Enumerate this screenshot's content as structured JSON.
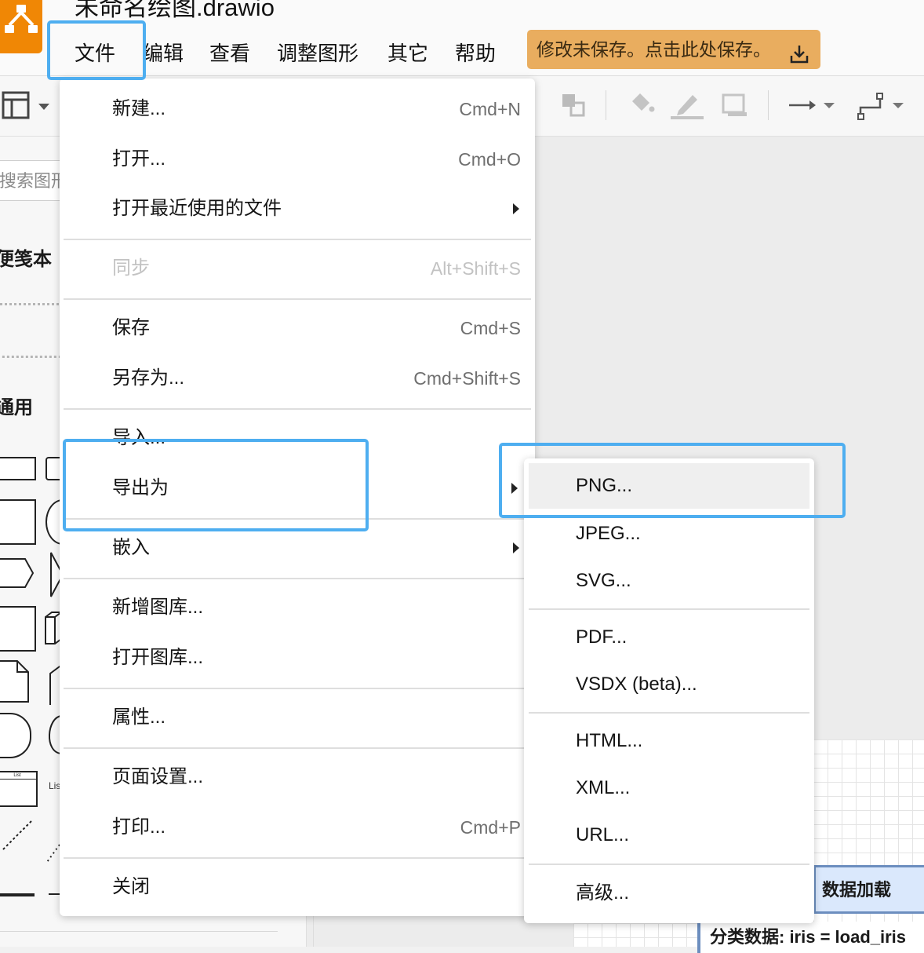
{
  "window": {
    "title": "未命名绘图.drawio"
  },
  "menubar": {
    "items": [
      "文件",
      "编辑",
      "查看",
      "调整图形",
      "其它",
      "帮助"
    ]
  },
  "save_banner": {
    "text": "修改未保存。点击此处保存。"
  },
  "sidebar": {
    "search_placeholder": "搜索图形",
    "sections": [
      "便笺本",
      "通用"
    ],
    "shape_label_list": "List",
    "shape_label_lis": "Lis"
  },
  "file_menu": {
    "items": [
      {
        "label": "新建...",
        "shortcut": "Cmd+N"
      },
      {
        "label": "打开...",
        "shortcut": "Cmd+O"
      },
      {
        "label": "打开最近使用的文件",
        "shortcut": ""
      },
      {
        "label": "同步",
        "shortcut": "Alt+Shift+S",
        "disabled": true
      },
      {
        "label": "保存",
        "shortcut": "Cmd+S"
      },
      {
        "label": "另存为...",
        "shortcut": "Cmd+Shift+S"
      },
      {
        "label": "导入...",
        "shortcut": ""
      },
      {
        "label": "导出为",
        "shortcut": ""
      },
      {
        "label": "嵌入",
        "shortcut": ""
      },
      {
        "label": "新增图库...",
        "shortcut": ""
      },
      {
        "label": "打开图库...",
        "shortcut": ""
      },
      {
        "label": "属性...",
        "shortcut": ""
      },
      {
        "label": "页面设置...",
        "shortcut": ""
      },
      {
        "label": "打印...",
        "shortcut": "Cmd+P"
      },
      {
        "label": "关闭",
        "shortcut": ""
      }
    ]
  },
  "export_menu": {
    "items": [
      "PNG...",
      "JPEG...",
      "SVG...",
      "PDF...",
      "VSDX (beta)...",
      "HTML...",
      "XML...",
      "URL...",
      "高级..."
    ],
    "highlighted": "PNG..."
  },
  "canvas": {
    "node_title": "数据加载",
    "node_body": "分类数据: iris = load_iris"
  },
  "colors": {
    "accent": "#4eaef0",
    "save_banner": "#e9ad5f",
    "logo": "#f08705",
    "node_fill": "#dae8fc",
    "node_stroke": "#6c8ebf"
  }
}
